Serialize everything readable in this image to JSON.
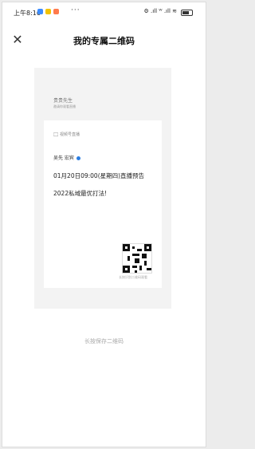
{
  "status_bar": {
    "time": "上午8:16",
    "more": "···",
    "signal_text": "⚙ .ıll ᵂ .ıll ≋",
    "icon_colors": [
      "#3b8cff",
      "#f2c200",
      "#ff7a4c"
    ]
  },
  "header": {
    "close_glyph": "✕",
    "title": "我的专属二维码"
  },
  "card": {
    "name": "贵贵先生",
    "sub": "邀请你观看直播",
    "category": "视频号直播",
    "author": "吴先 宏宾",
    "headline": "01月20日09:00(星期四)直播预告",
    "subline": "2022私域最优打法!",
    "qr_caption": "长按识别二维码观看"
  },
  "footer": {
    "save_hint": "长按保存二维码"
  }
}
